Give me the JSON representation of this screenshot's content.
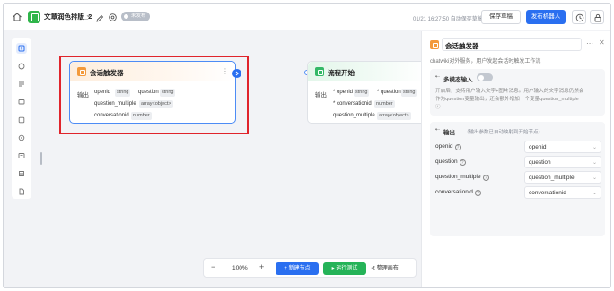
{
  "topbar": {
    "title": "文章润色排版_2",
    "unpublished_badge": "未发布",
    "save_status": "01/21 16:27:50 自动保存草稿",
    "save_draft_label": "保存草稿",
    "publish_label": "发布机器人"
  },
  "nodes": {
    "trigger": {
      "title": "会话触发器",
      "output_label": "输出",
      "vars": [
        {
          "name": "openid",
          "type": "string"
        },
        {
          "name": "question",
          "type": "string"
        },
        {
          "name": "question_multiple",
          "type": "array<object>"
        },
        {
          "name": "conversationid",
          "type": "number"
        }
      ]
    },
    "start": {
      "title": "流程开始",
      "output_label": "输出",
      "vars": [
        {
          "name": "* openid",
          "type": "string"
        },
        {
          "name": "* question",
          "type": "string"
        },
        {
          "name": "* conversationid",
          "type": "number"
        },
        {
          "name": "question_multiple",
          "type": "array<object>"
        }
      ]
    }
  },
  "bottom_toolbar": {
    "zoom_out": "−",
    "zoom": "100%",
    "zoom_in": "+",
    "add_node": "+ 新建节点",
    "run_test": "▸ 运行测试",
    "tidy_canvas": "整理画布"
  },
  "panel": {
    "title": "会话触发器",
    "description": "chatwiki对外服务，用户发起会话时触发工作流",
    "multimodal": {
      "title": "多模态输入",
      "text_line1": "开启后，支持用户输入文字+图片消息。用户输入的文字消息仍然会",
      "text_line2": "作为question变量输出，还会额外增加一个变量question_multiple",
      "enabled": false
    },
    "output": {
      "title": "输出",
      "hint": "（输出参数已自动映射到开始节点）",
      "rows": [
        {
          "name": "openid",
          "value": "openid"
        },
        {
          "name": "question",
          "value": "question"
        },
        {
          "name": "question_multiple",
          "value": "question_multiple"
        },
        {
          "name": "conversationid",
          "value": "conversationid"
        }
      ]
    }
  },
  "colors": {
    "accent": "#2a6ff0",
    "run_green": "#25b358",
    "highlight_red": "#e0242b",
    "trigger_orange": "#f39a3b"
  }
}
